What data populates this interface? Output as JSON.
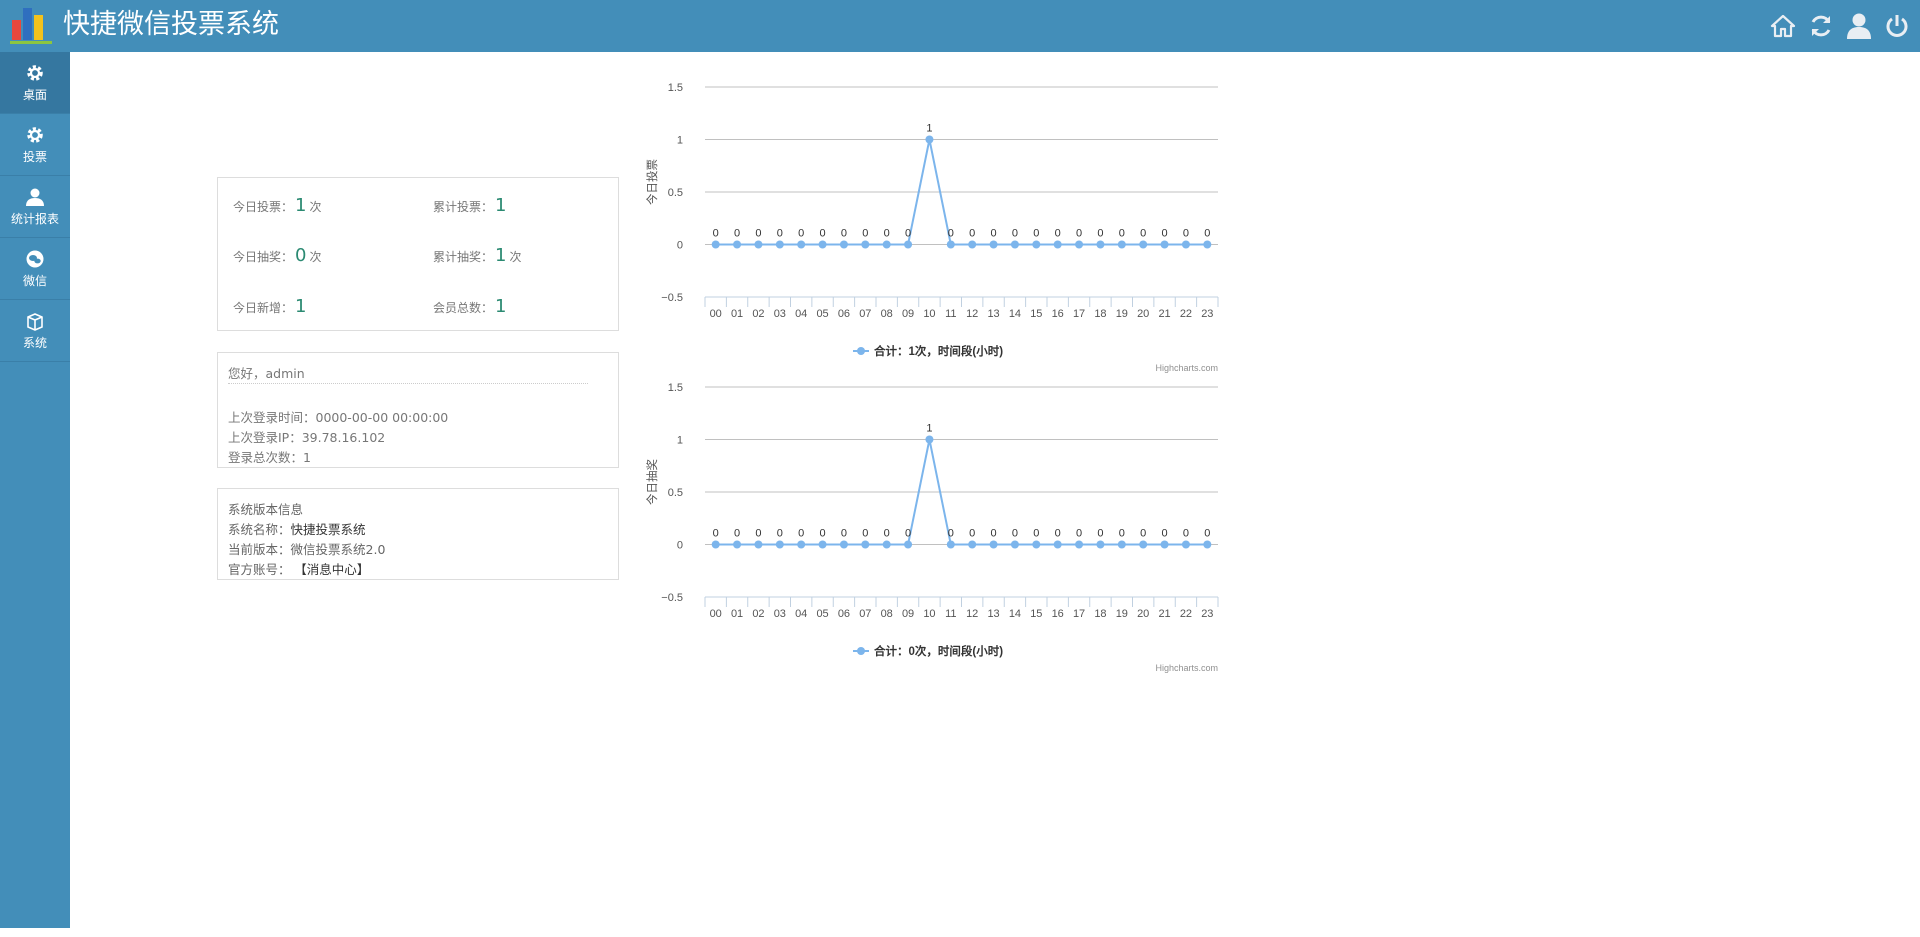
{
  "app": {
    "title": "快捷微信投票系统"
  },
  "top_icons": [
    "home-icon",
    "refresh-icon",
    "user-icon",
    "power-icon"
  ],
  "sidebar": {
    "items": [
      {
        "label": "桌面",
        "icon": "gear-icon",
        "active": true
      },
      {
        "label": "投票",
        "icon": "gear-icon",
        "active": false
      },
      {
        "label": "统计报表",
        "icon": "user-icon",
        "active": false
      },
      {
        "label": "微信",
        "icon": "wechat-icon",
        "active": false
      },
      {
        "label": "系统",
        "icon": "box-icon",
        "active": false
      }
    ]
  },
  "stats": {
    "today_votes": {
      "label": "今日投票：",
      "value": "1",
      "unit": "次"
    },
    "total_votes": {
      "label": "累计投票：",
      "value": "1",
      "unit": ""
    },
    "today_lottery": {
      "label": "今日抽奖：",
      "value": "0",
      "unit": "次"
    },
    "total_lottery": {
      "label": "累计抽奖：",
      "value": "1",
      "unit": "次"
    },
    "today_new": {
      "label": "今日新增：",
      "value": "1",
      "unit": ""
    },
    "members_total": {
      "label": "会员总数：",
      "value": "1",
      "unit": ""
    }
  },
  "login": {
    "greeting": "您好，admin",
    "last_login_time": "上次登录时间：0000-00-00 00:00:00",
    "last_login_ip": "上次登录IP：39.78.16.102",
    "login_count": "登录总次数：1"
  },
  "system": {
    "heading": "系统版本信息",
    "name_label": "系统名称：",
    "name_value": "快捷投票系统",
    "version_label": "当前版本：",
    "version_value": "微信投票系统2.0",
    "account_label": "官方账号：",
    "account_value": "【消息中心】"
  },
  "colors": {
    "header": "#438eb9",
    "series": "#7cb5ec",
    "stat_number": "#2b8a72"
  },
  "chart_data": [
    {
      "type": "line",
      "ylabel": "今日投票",
      "categories": [
        "00",
        "01",
        "02",
        "03",
        "04",
        "05",
        "06",
        "07",
        "08",
        "09",
        "10",
        "11",
        "12",
        "13",
        "14",
        "15",
        "16",
        "17",
        "18",
        "19",
        "20",
        "21",
        "22",
        "23"
      ],
      "series": [
        {
          "name": "合计：1次，时间段(小时)",
          "values": [
            0,
            0,
            0,
            0,
            0,
            0,
            0,
            0,
            0,
            0,
            1,
            0,
            0,
            0,
            0,
            0,
            0,
            0,
            0,
            0,
            0,
            0,
            0,
            0
          ]
        }
      ],
      "yticks": [
        "1.5",
        "1",
        "0.5",
        "0",
        "−0.5"
      ],
      "ylim": [
        -0.5,
        1.5
      ],
      "credits": "Highcharts.com",
      "grid": true,
      "legend": "bottom"
    },
    {
      "type": "line",
      "ylabel": "今日抽奖",
      "categories": [
        "00",
        "01",
        "02",
        "03",
        "04",
        "05",
        "06",
        "07",
        "08",
        "09",
        "10",
        "11",
        "12",
        "13",
        "14",
        "15",
        "16",
        "17",
        "18",
        "19",
        "20",
        "21",
        "22",
        "23"
      ],
      "series": [
        {
          "name": "合计：0次，时间段(小时)",
          "values": [
            0,
            0,
            0,
            0,
            0,
            0,
            0,
            0,
            0,
            0,
            1,
            0,
            0,
            0,
            0,
            0,
            0,
            0,
            0,
            0,
            0,
            0,
            0,
            0
          ]
        }
      ],
      "yticks": [
        "1.5",
        "1",
        "0.5",
        "0",
        "−0.5"
      ],
      "ylim": [
        -0.5,
        1.5
      ],
      "credits": "Highcharts.com",
      "grid": true,
      "legend": "bottom"
    }
  ]
}
